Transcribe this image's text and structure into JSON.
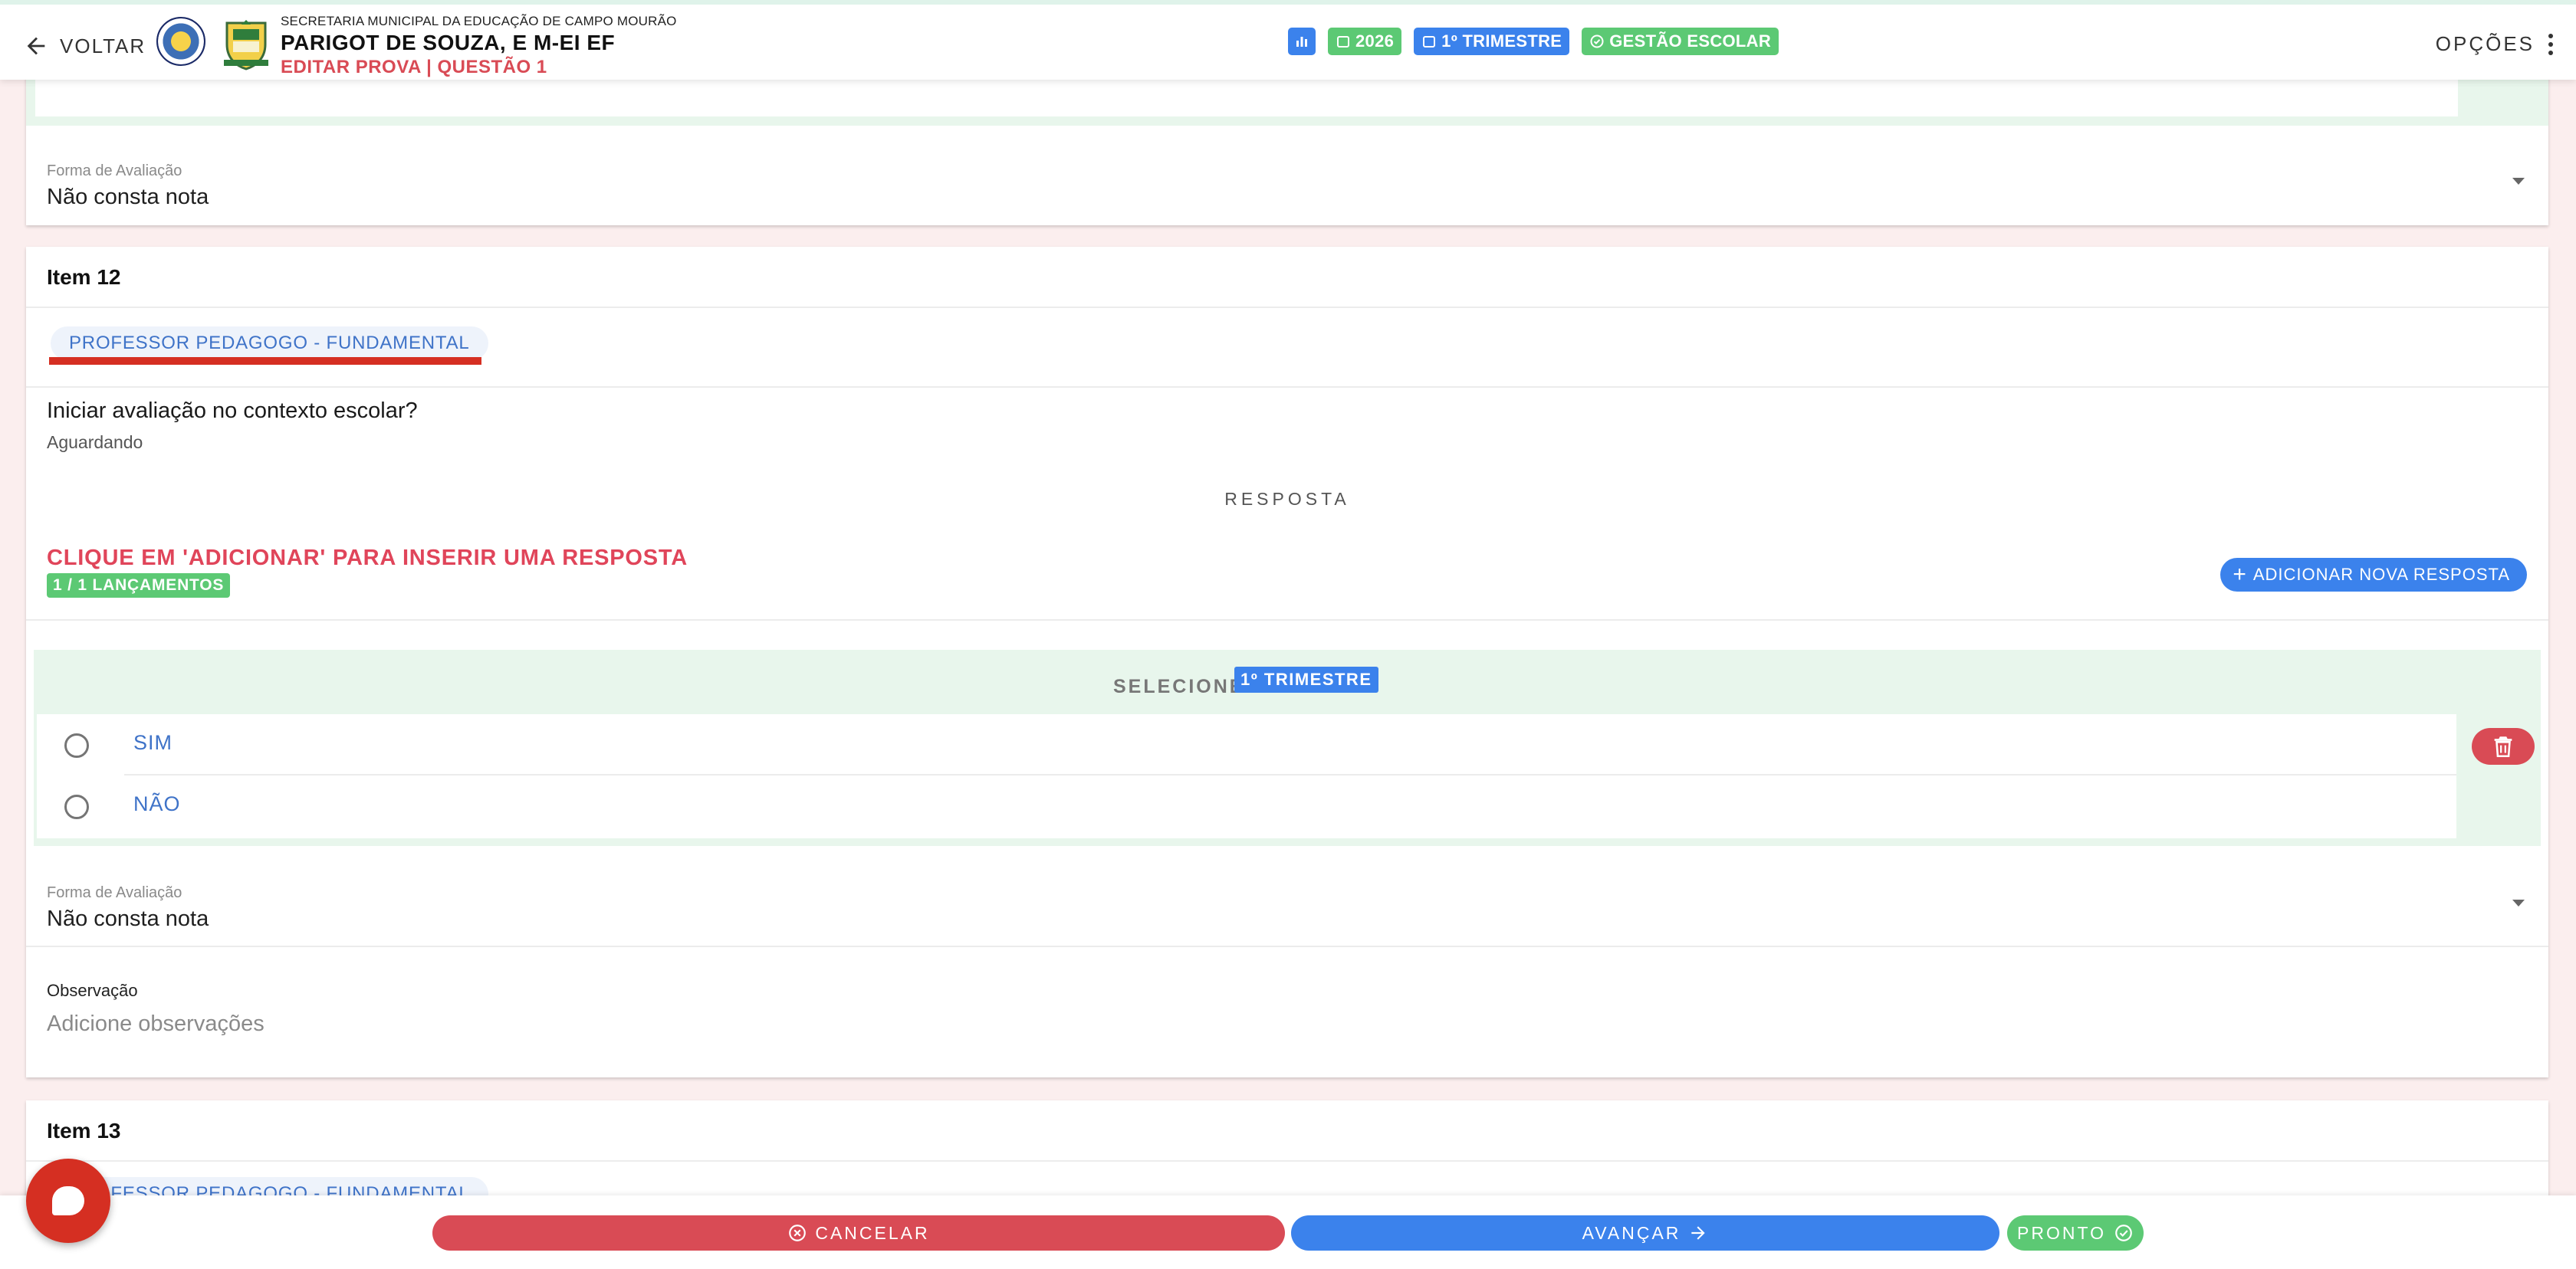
{
  "header": {
    "back_label": "VOLTAR",
    "secretaria": "SECRETARIA MUNICIPAL DA EDUCAÇÃO DE CAMPO MOURÃO",
    "school_name": "PARIGOT DE SOUZA, E M-EI EF",
    "edit_label": "EDITAR PROVA | QUESTÃO 1",
    "chips": {
      "year": "2026",
      "trimester": "1º TRIMESTRE",
      "management": "GESTÃO ESCOLAR"
    },
    "options_label": "OPÇÕES"
  },
  "previous_item": {
    "form_label": "Forma de Avaliação",
    "form_value": "Não consta nota"
  },
  "item12": {
    "title": "Item 12",
    "role": "PROFESSOR PEDAGOGO - FUNDAMENTAL",
    "question": "Iniciar avaliação no contexto escolar?",
    "status": "Aguardando",
    "response_heading": "RESPOSTA",
    "click_prompt": "CLIQUE EM 'ADICIONAR' PARA INSERIR UMA RESPOSTA",
    "launches": "1 / 1 LANÇAMENTOS",
    "add_button": "ADICIONAR NOVA RESPOSTA",
    "select_label": "SELECIONE",
    "trimester_tag": "1º TRIMESTRE",
    "options": [
      "SIM",
      "NÃO"
    ],
    "form_label": "Forma de Avaliação",
    "form_value": "Não consta nota",
    "obs_label": "Observação",
    "obs_placeholder": "Adicione observações"
  },
  "item13": {
    "title": "Item 13",
    "role": "PROFESSOR PEDAGOGO - FUNDAMENTAL"
  },
  "footer": {
    "cancel": "CANCELAR",
    "next": "AVANÇAR",
    "done": "PRONTO"
  },
  "colors": {
    "primary_blue": "#3b82ec",
    "success_green": "#5cc974",
    "danger_red": "#d94b55",
    "accent_red": "#d52f22"
  }
}
